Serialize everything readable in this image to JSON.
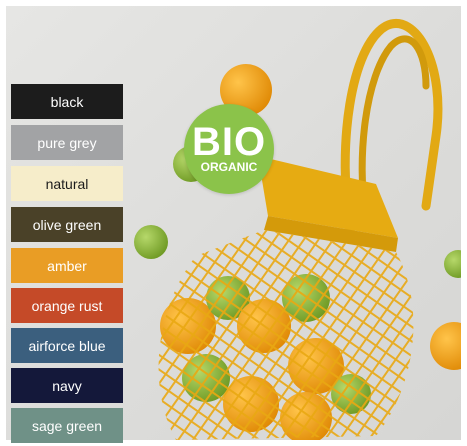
{
  "swatches": [
    {
      "label": "black",
      "bg": "#1c1c1c",
      "fg": "#ffffff"
    },
    {
      "label": "pure grey",
      "bg": "#a2a3a5",
      "fg": "#ffffff"
    },
    {
      "label": "natural",
      "bg": "#f6edca",
      "fg": "#1c1c1c"
    },
    {
      "label": "olive green",
      "bg": "#4a4128",
      "fg": "#ffffff"
    },
    {
      "label": "amber",
      "bg": "#e99d25",
      "fg": "#ffffff"
    },
    {
      "label": "orange rust",
      "bg": "#c54a28",
      "fg": "#ffffff"
    },
    {
      "label": "airforce blue",
      "bg": "#3b5f7e",
      "fg": "#ffffff"
    },
    {
      "label": "navy",
      "bg": "#14183a",
      "fg": "#ffffff"
    },
    {
      "label": "sage green",
      "bg": "#6f9187",
      "fg": "#ffffff"
    }
  ],
  "badge": {
    "line1": "BIO",
    "line2": "ORGANIC",
    "color": "#8bc34a"
  },
  "photo": {
    "subject": "mesh-bag-with-oranges-and-apples"
  }
}
